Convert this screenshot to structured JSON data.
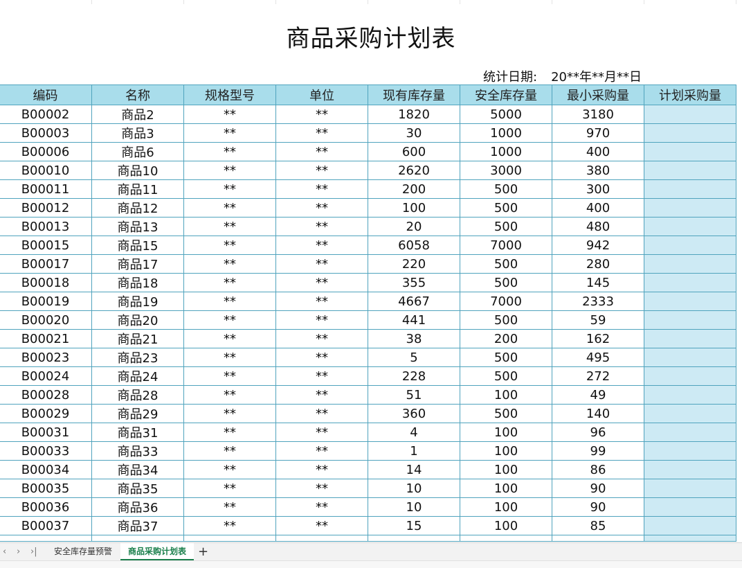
{
  "title": "商品采购计划表",
  "date": {
    "label": "统计日期:",
    "value": "20**年**月**日"
  },
  "columns": [
    "编码",
    "名称",
    "规格型号",
    "单位",
    "现有库存量",
    "安全库存量",
    "最小采购量",
    "计划采购量"
  ],
  "rows": [
    [
      "B00002",
      "商品2",
      "**",
      "**",
      "1820",
      "5000",
      "3180",
      ""
    ],
    [
      "B00003",
      "商品3",
      "**",
      "**",
      "30",
      "1000",
      "970",
      ""
    ],
    [
      "B00006",
      "商品6",
      "**",
      "**",
      "600",
      "1000",
      "400",
      ""
    ],
    [
      "B00010",
      "商品10",
      "**",
      "**",
      "2620",
      "3000",
      "380",
      ""
    ],
    [
      "B00011",
      "商品11",
      "**",
      "**",
      "200",
      "500",
      "300",
      ""
    ],
    [
      "B00012",
      "商品12",
      "**",
      "**",
      "100",
      "500",
      "400",
      ""
    ],
    [
      "B00013",
      "商品13",
      "**",
      "**",
      "20",
      "500",
      "480",
      ""
    ],
    [
      "B00015",
      "商品15",
      "**",
      "**",
      "6058",
      "7000",
      "942",
      ""
    ],
    [
      "B00017",
      "商品17",
      "**",
      "**",
      "220",
      "500",
      "280",
      ""
    ],
    [
      "B00018",
      "商品18",
      "**",
      "**",
      "355",
      "500",
      "145",
      ""
    ],
    [
      "B00019",
      "商品19",
      "**",
      "**",
      "4667",
      "7000",
      "2333",
      ""
    ],
    [
      "B00020",
      "商品20",
      "**",
      "**",
      "441",
      "500",
      "59",
      ""
    ],
    [
      "B00021",
      "商品21",
      "**",
      "**",
      "38",
      "200",
      "162",
      ""
    ],
    [
      "B00023",
      "商品23",
      "**",
      "**",
      "5",
      "500",
      "495",
      ""
    ],
    [
      "B00024",
      "商品24",
      "**",
      "**",
      "228",
      "500",
      "272",
      ""
    ],
    [
      "B00028",
      "商品28",
      "**",
      "**",
      "51",
      "100",
      "49",
      ""
    ],
    [
      "B00029",
      "商品29",
      "**",
      "**",
      "360",
      "500",
      "140",
      ""
    ],
    [
      "B00031",
      "商品31",
      "**",
      "**",
      "4",
      "100",
      "96",
      ""
    ],
    [
      "B00033",
      "商品33",
      "**",
      "**",
      "1",
      "100",
      "99",
      ""
    ],
    [
      "B00034",
      "商品34",
      "**",
      "**",
      "14",
      "100",
      "86",
      ""
    ],
    [
      "B00035",
      "商品35",
      "**",
      "**",
      "10",
      "100",
      "90",
      ""
    ],
    [
      "B00036",
      "商品36",
      "**",
      "**",
      "10",
      "100",
      "90",
      ""
    ],
    [
      "B00037",
      "商品37",
      "**",
      "**",
      "15",
      "100",
      "85",
      ""
    ]
  ],
  "tabs": [
    {
      "label": "安全库存量预警",
      "active": false
    },
    {
      "label": "商品采购计划表",
      "active": true
    }
  ],
  "add_tab": "+",
  "colors": {
    "header_bg": "#a9ddeb",
    "plan_col_bg": "#cdeaf4",
    "grid_border": "#4fa3bd",
    "active_tab": "#1a7f4b"
  }
}
